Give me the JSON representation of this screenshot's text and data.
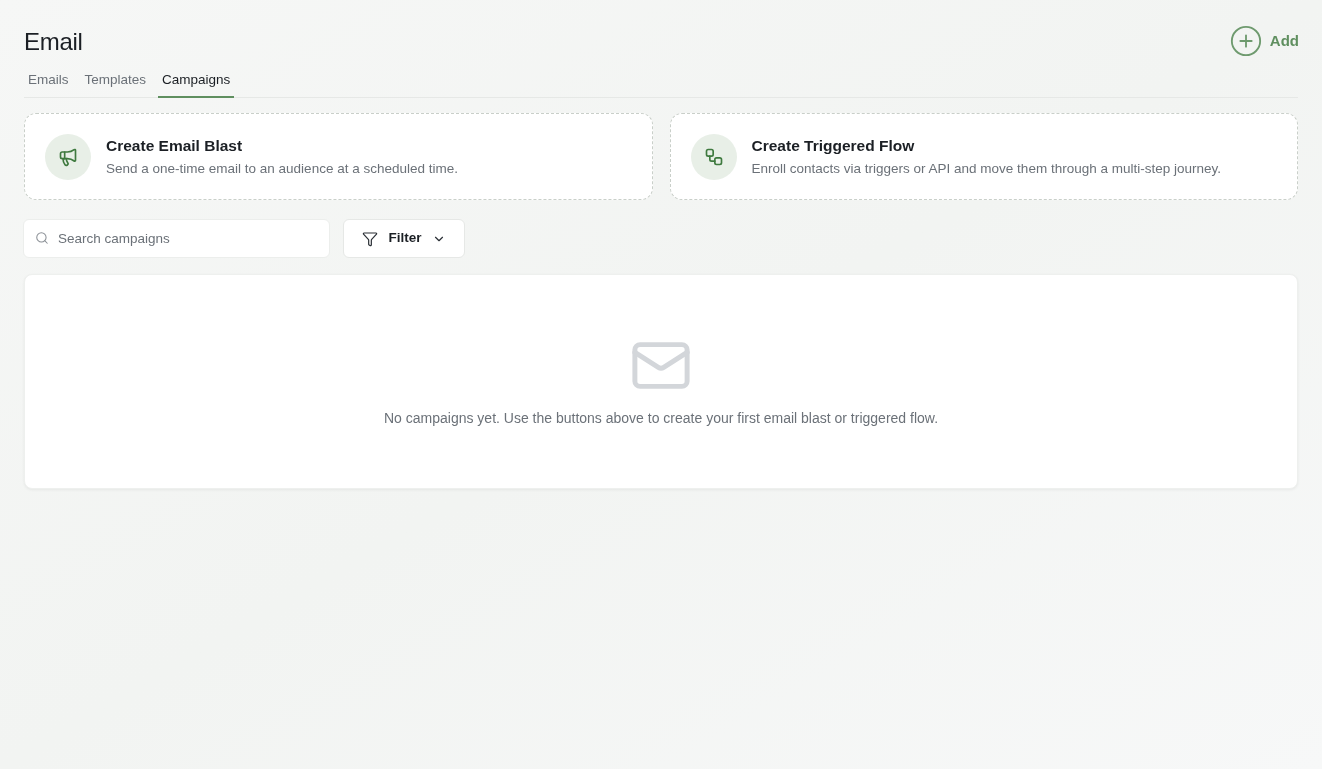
{
  "header": {
    "title": "Email",
    "add_button": {
      "label": "Add"
    }
  },
  "tabs": [
    {
      "label": "Emails",
      "selected": false
    },
    {
      "label": "Templates",
      "selected": false
    },
    {
      "label": "Campaigns",
      "selected": true
    }
  ],
  "action_cards": [
    {
      "kind": "blast",
      "title": "Create Email Blast",
      "description": "Send a one-time email to an audience at a scheduled time."
    },
    {
      "kind": "flow",
      "title": "Create Triggered Flow",
      "description": "Enroll contacts via triggers or API and move them through a multi-step journey."
    }
  ],
  "search": {
    "placeholder": "Search campaigns"
  },
  "filter_button": {
    "label": "Filter"
  },
  "empty_state": {
    "message": "No campaigns yet. Use the buttons above to create your first email blast or triggered flow."
  }
}
